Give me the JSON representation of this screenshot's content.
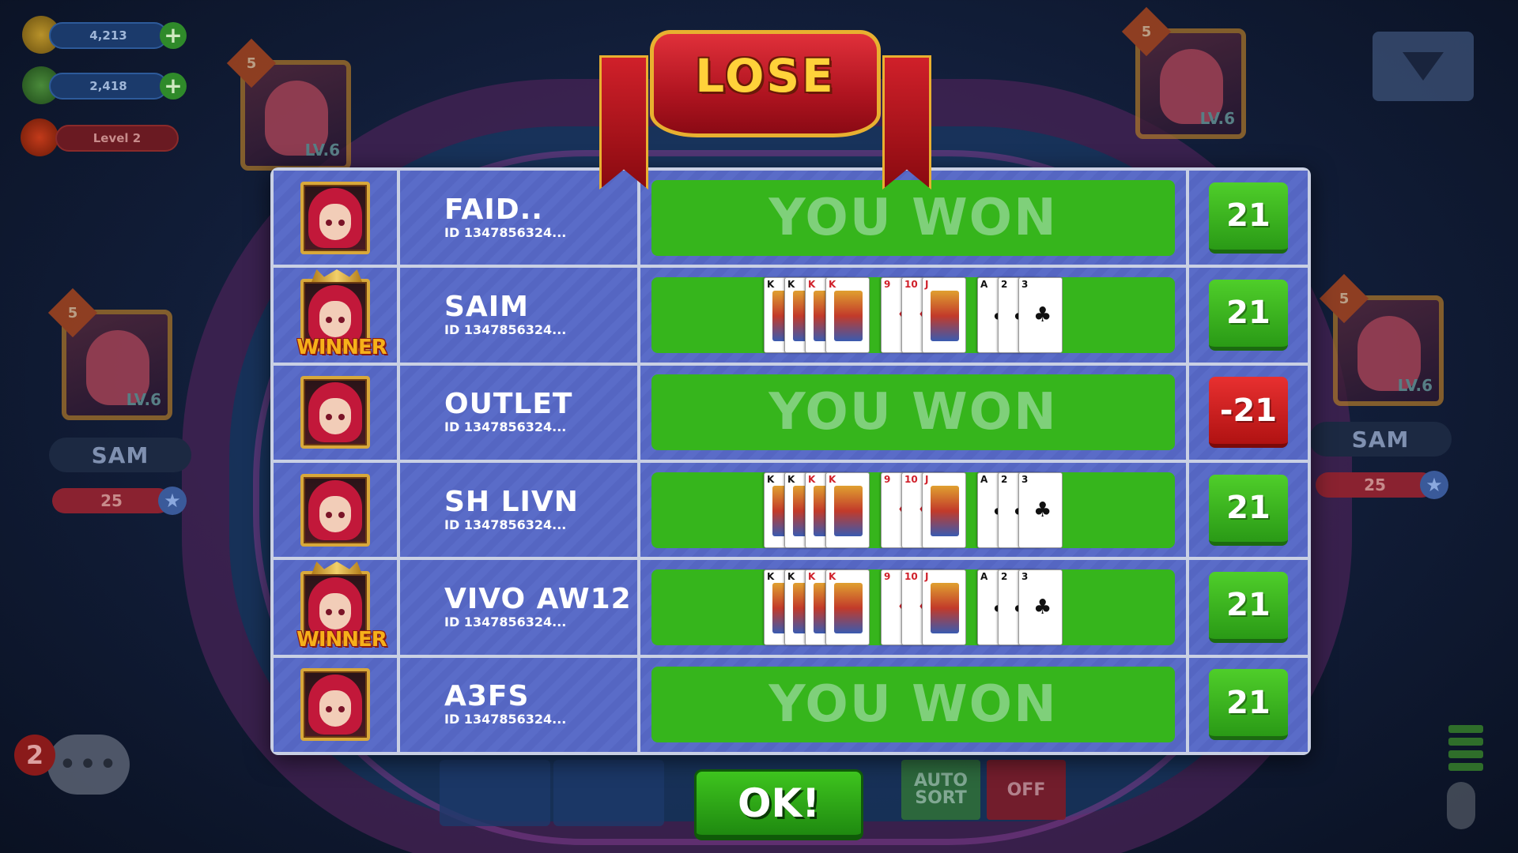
{
  "hud": {
    "coins": "4,213",
    "gems": "2,418",
    "level": "Level 2"
  },
  "background_players": [
    {
      "name": "SAM",
      "score": "25",
      "level": "LV.6",
      "badge": "5"
    },
    {
      "name": "SAM",
      "score": "25",
      "level": "LV.6",
      "badge": "5"
    },
    {
      "name": "",
      "score": "",
      "level": "LV.6",
      "badge": "5"
    },
    {
      "name": "",
      "score": "",
      "level": "LV.6",
      "badge": "5"
    }
  ],
  "chat": {
    "unread": "2"
  },
  "controls": {
    "autosort": "AUTO SORT",
    "off": "OFF"
  },
  "banner": {
    "title": "LOSE"
  },
  "ok_label": "OK!",
  "results": [
    {
      "name": "FAID..",
      "id": "ID 1347856324...",
      "winner": false,
      "result": "won",
      "won_text": "YOU WON",
      "score": "21",
      "score_kind": "pos"
    },
    {
      "name": "SAIM",
      "id": "ID 1347856324...",
      "winner": true,
      "winner_text": "WINNER",
      "result": "cards",
      "score": "21",
      "score_kind": "pos"
    },
    {
      "name": "OUTLET",
      "id": "ID 1347856324...",
      "winner": false,
      "result": "won",
      "won_text": "YOU WON",
      "score": "-21",
      "score_kind": "neg"
    },
    {
      "name": "SH LIVN",
      "id": "ID 1347856324...",
      "winner": false,
      "result": "cards",
      "score": "21",
      "score_kind": "pos"
    },
    {
      "name": "VIVO AW12",
      "id": "ID 1347856324...",
      "winner": true,
      "winner_text": "WINNER",
      "result": "cards",
      "score": "21",
      "score_kind": "pos"
    },
    {
      "name": "A3FS",
      "id": "ID 1347856324...",
      "winner": false,
      "result": "won",
      "won_text": "YOU WON",
      "score": "21",
      "score_kind": "pos"
    }
  ],
  "hand": [
    [
      {
        "rank": "K",
        "suit": "♣",
        "color": "blk",
        "face": true
      },
      {
        "rank": "K",
        "suit": "♠",
        "color": "blk",
        "face": true
      },
      {
        "rank": "K",
        "suit": "♦",
        "color": "red",
        "face": true
      },
      {
        "rank": "K",
        "suit": "♥",
        "color": "red",
        "face": true
      }
    ],
    [
      {
        "rank": "9",
        "suit": "♦",
        "color": "red",
        "face": false
      },
      {
        "rank": "10",
        "suit": "♦",
        "color": "red",
        "face": false
      },
      {
        "rank": "J",
        "suit": "♦",
        "color": "red",
        "face": true
      }
    ],
    [
      {
        "rank": "A",
        "suit": "♣",
        "color": "blk",
        "face": false
      },
      {
        "rank": "2",
        "suit": "♣",
        "color": "blk",
        "face": false
      },
      {
        "rank": "3",
        "suit": "♣",
        "color": "blk",
        "face": false
      }
    ]
  ],
  "colors": {
    "won_green": "#36b51c",
    "score_green": "#2a9a16",
    "score_red": "#b01212",
    "table_blue": "#5a6cc8",
    "banner_red": "#b01420",
    "gold": "#e8b030"
  }
}
